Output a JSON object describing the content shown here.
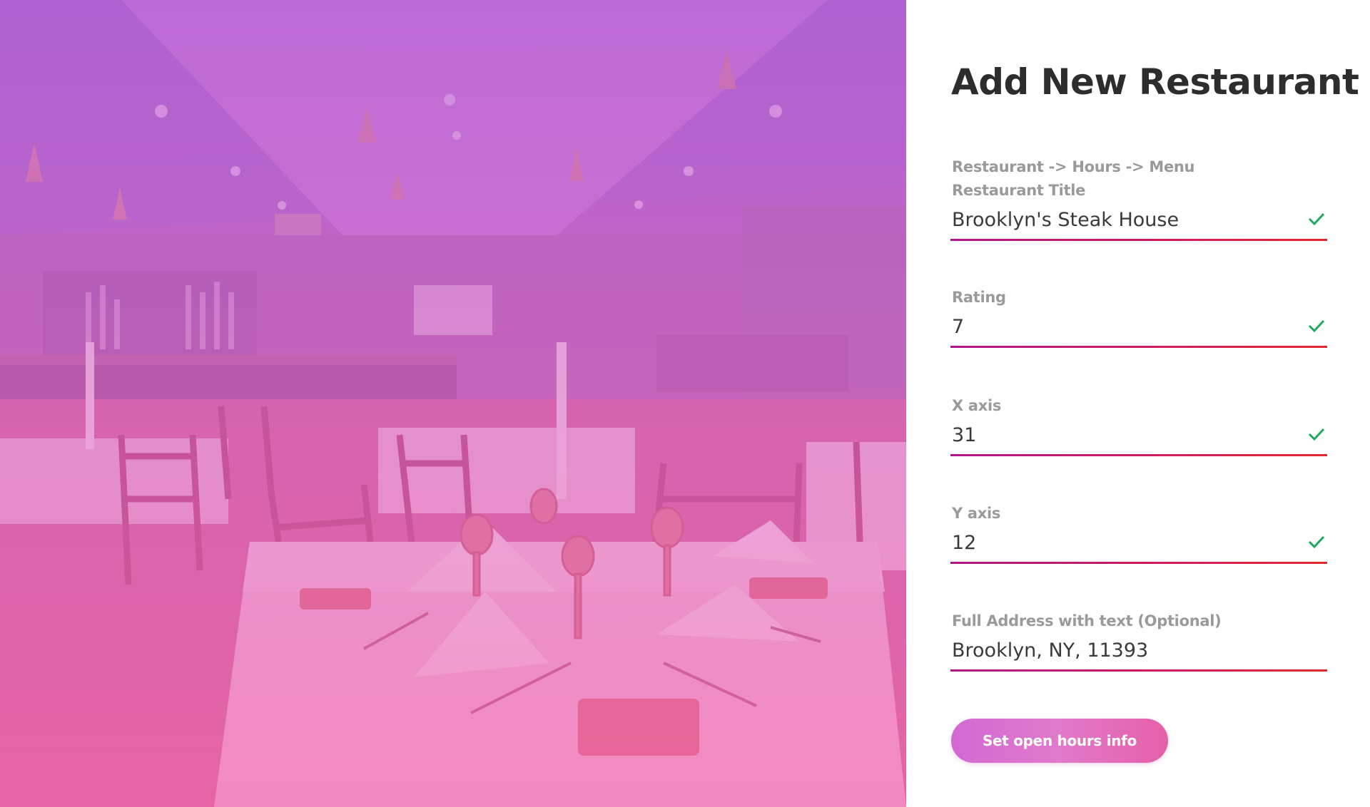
{
  "hero": {
    "icon": "restaurant-interior-photo"
  },
  "form": {
    "title": "Add New Restaurant",
    "breadcrumb": "Restaurant -> Hours -> Menu",
    "fields": [
      {
        "label": "Restaurant Title",
        "value": "Brooklyn's Steak House",
        "valid": true
      },
      {
        "label": "Rating",
        "value": "7",
        "valid": true
      },
      {
        "label": "X axis",
        "value": "31",
        "valid": true
      },
      {
        "label": "Y axis",
        "value": "12",
        "valid": true
      },
      {
        "label": "Full Address with text (Optional)",
        "value": "Brooklyn, NY, 11393",
        "valid": false
      }
    ],
    "submit_label": "Set open hours info"
  },
  "colors": {
    "accent_start": "#b0178c",
    "accent_end": "#e0282e",
    "check": "#1faa5a",
    "button_start": "#d269d4",
    "button_end": "#e65fa8"
  }
}
